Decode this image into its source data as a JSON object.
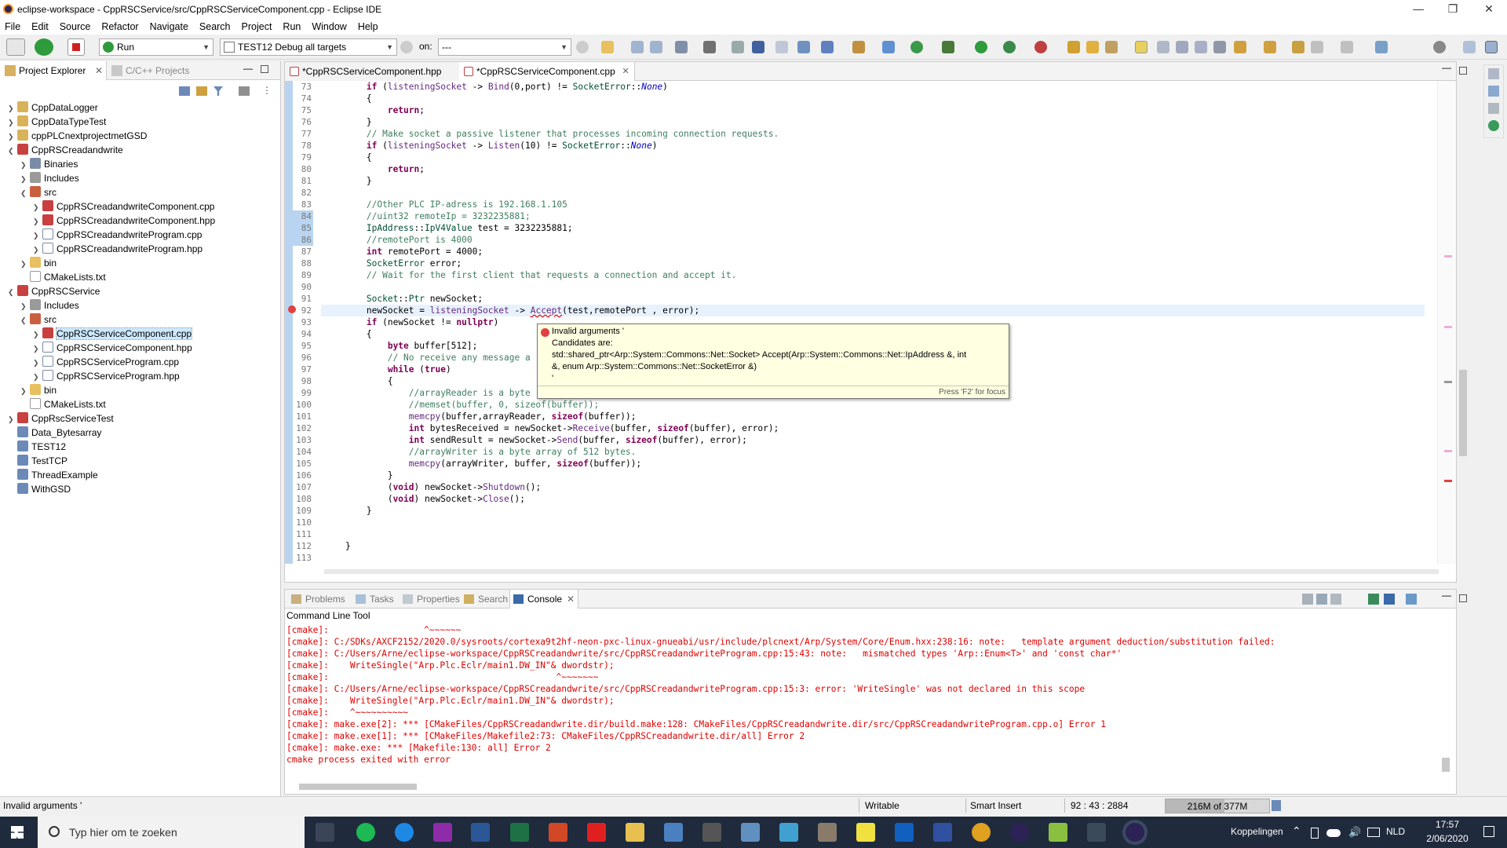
{
  "window": {
    "title": "eclipse-workspace - CppRSCService/src/CppRSCServiceComponent.cpp - Eclipse IDE"
  },
  "menu": [
    "File",
    "Edit",
    "Source",
    "Refactor",
    "Navigate",
    "Search",
    "Project",
    "Run",
    "Window",
    "Help"
  ],
  "toolbar": {
    "launch_mode": "Run",
    "launch_config": "TEST12 Debug all targets",
    "on_label": "on:",
    "target": "---"
  },
  "project_explorer": {
    "tabs": [
      "Project Explorer",
      "C/C++ Projects"
    ],
    "items": [
      {
        "label": "CppDataLogger"
      },
      {
        "label": "CppDataTypeTest"
      },
      {
        "label": "cppPLCnextprojectmetGSD"
      },
      {
        "label": "CppRSCreadandwrite"
      },
      {
        "label": "Binaries"
      },
      {
        "label": "Includes"
      },
      {
        "label": "src"
      },
      {
        "label": "CppRSCreadandwriteComponent.cpp"
      },
      {
        "label": "CppRSCreadandwriteComponent.hpp"
      },
      {
        "label": "CppRSCreadandwriteProgram.cpp"
      },
      {
        "label": "CppRSCreadandwriteProgram.hpp"
      },
      {
        "label": "bin"
      },
      {
        "label": "CMakeLists.txt"
      },
      {
        "label": "CppRSCService"
      },
      {
        "label": "Includes"
      },
      {
        "label": "src"
      },
      {
        "label": "CppRSCServiceComponent.cpp"
      },
      {
        "label": "CppRSCServiceComponent.hpp"
      },
      {
        "label": "CppRSCServiceProgram.cpp"
      },
      {
        "label": "CppRSCServiceProgram.hpp"
      },
      {
        "label": "bin"
      },
      {
        "label": "CMakeLists.txt"
      },
      {
        "label": "CppRscServiceTest"
      },
      {
        "label": "Data_Bytesarray"
      },
      {
        "label": "TEST12"
      },
      {
        "label": "TestTCP"
      },
      {
        "label": "ThreadExample"
      },
      {
        "label": "WithGSD"
      }
    ]
  },
  "editor": {
    "tabs": [
      "*CppRSCServiceComponent.hpp",
      "*CppRSCServiceComponent.cpp"
    ],
    "line_numbers": [
      "73",
      "74",
      "75",
      "76",
      "77",
      "78",
      "79",
      "80",
      "81",
      "82",
      "83",
      "84",
      "85",
      "86",
      "87",
      "88",
      "89",
      "90",
      "91",
      "92",
      "93",
      "94",
      "95",
      "96",
      "97",
      "98",
      "99",
      "100",
      "101",
      "102",
      "103",
      "104",
      "105",
      "106",
      "107",
      "108",
      "109",
      "110",
      "111",
      "112",
      "113"
    ],
    "tooltip": {
      "title": "Invalid arguments '",
      "candidates_label": "Candidates are:",
      "candidate_line1": "std::shared_ptr<Arp::System::Commons::Net::Socket> Accept(Arp::System::Commons::Net::IpAddress &, int",
      "candidate_line2": "&, enum Arp::System::Commons::Net::SocketError &)",
      "candidate_line3": "'",
      "footer": "Press 'F2' for focus"
    }
  },
  "console": {
    "tabs": [
      "Problems",
      "Tasks",
      "Properties",
      "Search",
      "Console"
    ],
    "header": "Command Line Tool",
    "lines": [
      "[cmake]:                  ^~~~~~~",
      "[cmake]: C:/SDKs/AXCF2152/2020.0/sysroots/cortexa9t2hf-neon-pxc-linux-gnueabi/usr/include/plcnext/Arp/System/Core/Enum.hxx:238:16: note:   template argument deduction/substitution failed:",
      "[cmake]: C:/Users/Arne/eclipse-workspace/CppRSCreadandwrite/src/CppRSCreadandwriteProgram.cpp:15:43: note:   mismatched types 'Arp::Enum<T>' and 'const char*'",
      "[cmake]:    WriteSingle(\"Arp.Plc.Eclr/main1.DW_IN\"& dwordstr);",
      "[cmake]:                                           ^~~~~~~~",
      "[cmake]: C:/Users/Arne/eclipse-workspace/CppRSCreadandwrite/src/CppRSCreadandwriteProgram.cpp:15:3: error: 'WriteSingle' was not declared in this scope",
      "[cmake]:    WriteSingle(\"Arp.Plc.Eclr/main1.DW_IN\"& dwordstr);",
      "[cmake]:    ^~~~~~~~~~~",
      "[cmake]: make.exe[2]: *** [CMakeFiles/CppRSCreadandwrite.dir/build.make:128: CMakeFiles/CppRSCreadandwrite.dir/src/CppRSCreadandwriteProgram.cpp.o] Error 1",
      "[cmake]: make.exe[1]: *** [CMakeFiles/Makefile2:73: CMakeFiles/CppRSCreadandwrite.dir/all] Error 2",
      "[cmake]: make.exe: *** [Makefile:130: all] Error 2",
      "cmake process exited with error"
    ]
  },
  "status": {
    "message": "Invalid arguments '",
    "writable": "Writable",
    "insert_mode": "Smart Insert",
    "position": "92 : 43 : 2884",
    "heap": "216M of 377M"
  },
  "taskbar": {
    "search_placeholder": "Typ hier om te zoeken",
    "links_label": "Koppelingen",
    "language": "NLD",
    "time": "17:57",
    "date": "2/06/2020"
  },
  "colors": {
    "keyword": "#7f0055",
    "comment": "#3f7f5f",
    "error": "#e00000",
    "selection": "#cce8ff"
  }
}
